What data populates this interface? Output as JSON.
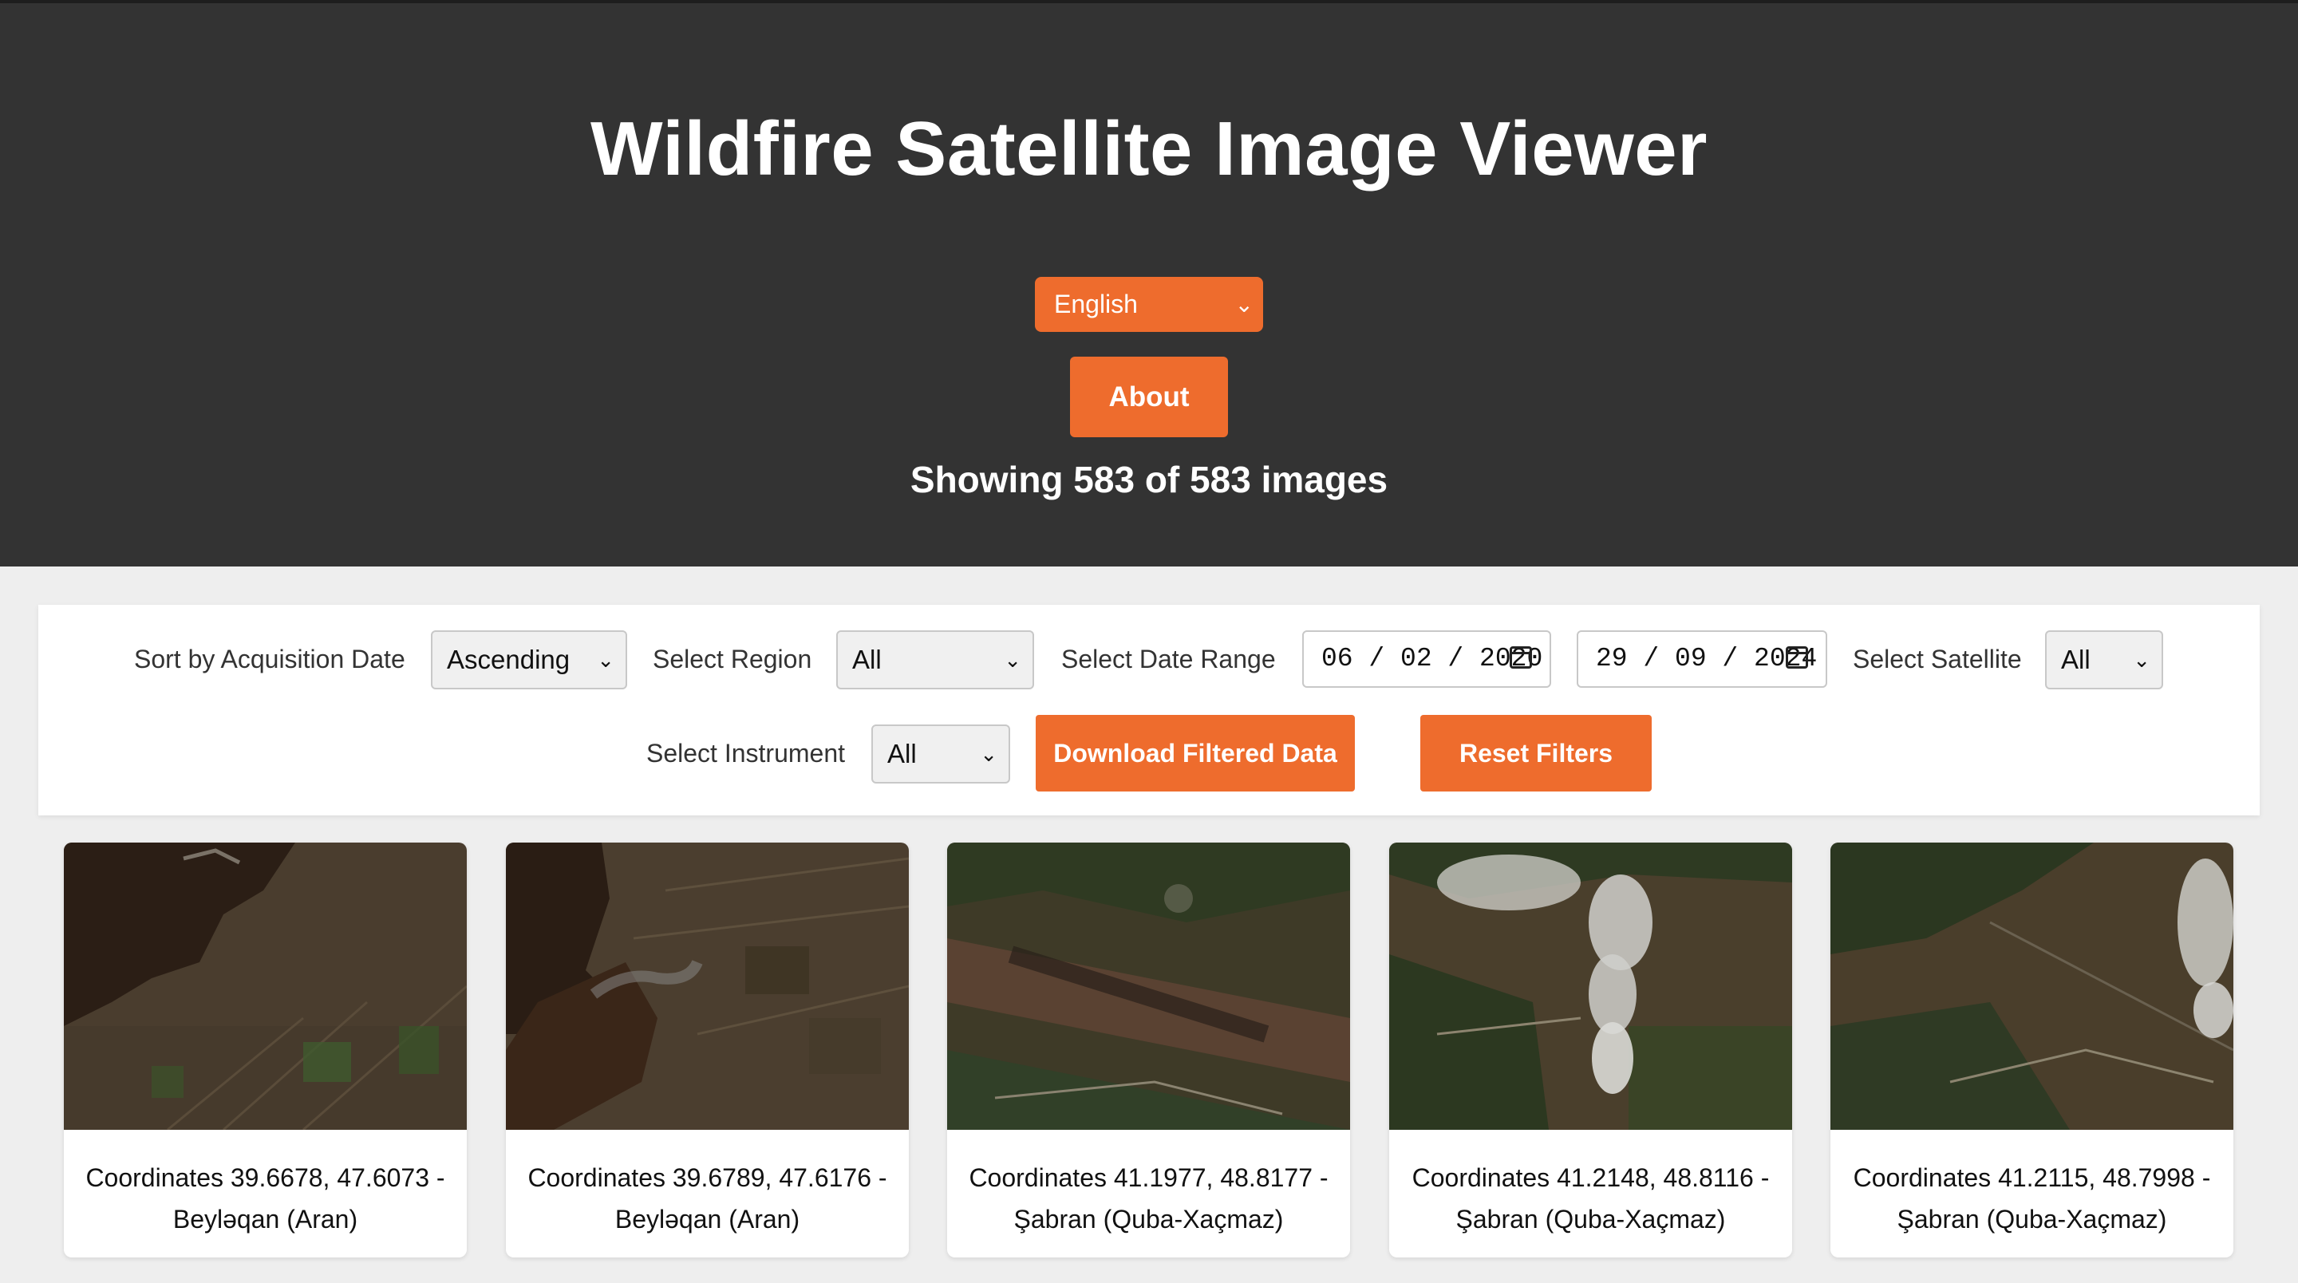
{
  "header": {
    "title": "Wildfire Satellite Image Viewer",
    "language": "English",
    "about_label": "About",
    "count_text": "Showing 583 of 583 images"
  },
  "filters": {
    "sort_label": "Sort by Acquisition Date",
    "sort_value": "Ascending",
    "region_label": "Select Region",
    "region_value": "All",
    "date_range_label": "Select Date Range",
    "date_from": "06 / 02 / 2020",
    "date_to": "29 / 09 / 2024",
    "satellite_label": "Select Satellite",
    "satellite_value": "All",
    "instrument_label": "Select Instrument",
    "instrument_value": "All",
    "download_label": "Download Filtered Data",
    "reset_label": "Reset Filters"
  },
  "cards": [
    {
      "line1": "Coordinates 39.6678, 47.6073 -",
      "line2": "Beyləqan (Aran)"
    },
    {
      "line1": "Coordinates 39.6789, 47.6176 -",
      "line2": "Beyləqan (Aran)"
    },
    {
      "line1": "Coordinates 41.1977, 48.8177 -",
      "line2": "Şabran (Quba-Xaçmaz)"
    },
    {
      "line1": "Coordinates 41.2148, 48.8116 -",
      "line2": "Şabran (Quba-Xaçmaz)"
    },
    {
      "line1": "Coordinates 41.2115, 48.7998 -",
      "line2": "Şabran (Quba-Xaçmaz)"
    }
  ],
  "colors": {
    "accent": "#ee6c2d",
    "header_bg": "#333333"
  }
}
